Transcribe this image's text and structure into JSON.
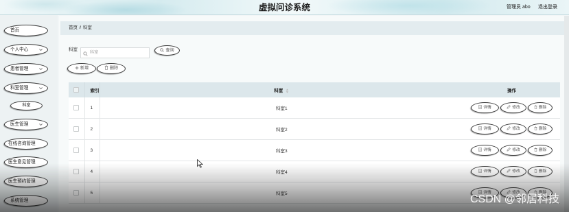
{
  "app": {
    "title": "虚拟问诊系统",
    "user_label": "管理员 abo",
    "logout_label": "退出登录"
  },
  "sidebar": {
    "items": [
      {
        "label": "首页",
        "has_submenu": false
      },
      {
        "label": "个人中心",
        "has_submenu": true,
        "icon": "chevron-down-icon"
      },
      {
        "label": "患者管理",
        "has_submenu": true,
        "icon": "chevron-down-icon"
      },
      {
        "label": "科室管理",
        "has_submenu": true,
        "expanded": true,
        "icon": "chevron-down-icon",
        "children": [
          {
            "label": "科室",
            "active": true
          }
        ]
      },
      {
        "label": "医生管理",
        "has_submenu": true,
        "icon": "chevron-down-icon"
      },
      {
        "label": "在线咨询管理",
        "has_submenu": false
      },
      {
        "label": "医生意见管理",
        "has_submenu": false
      },
      {
        "label": "医生预约管理",
        "has_submenu": false
      },
      {
        "label": "系统管理",
        "has_submenu": false
      }
    ]
  },
  "breadcrumb": {
    "home": "首页",
    "separator": "/",
    "current": "科室"
  },
  "search": {
    "label": "科室",
    "placeholder": "科室",
    "icon": "search-icon",
    "button_label": "查询",
    "button_icon": "search-icon"
  },
  "toolbar": {
    "add_label": "新增",
    "add_icon": "plus-icon",
    "delete_label": "删除",
    "delete_icon": "trash-icon"
  },
  "table": {
    "columns": {
      "index": "索引",
      "name": "科室",
      "actions": "操作"
    },
    "rows": [
      {
        "index": "1",
        "name": "科室1"
      },
      {
        "index": "2",
        "name": "科室2"
      },
      {
        "index": "3",
        "name": "科室3"
      },
      {
        "index": "4",
        "name": "科室4"
      },
      {
        "index": "5",
        "name": "科室5"
      }
    ],
    "row_actions": {
      "detail": "详情",
      "detail_icon": "document-icon",
      "edit": "修改",
      "edit_icon": "pencil-icon",
      "delete": "删除",
      "delete_icon": "trash-icon"
    }
  },
  "watermark": {
    "text": "CSDN @邻居科技"
  },
  "colors": {
    "header_bg": "#d5ebef",
    "breadcrumb_bg": "#e3ecef",
    "table_header_bg": "#dce7eb",
    "pill_border": "#3a3a3a",
    "page_bg": "#f7fafa"
  }
}
